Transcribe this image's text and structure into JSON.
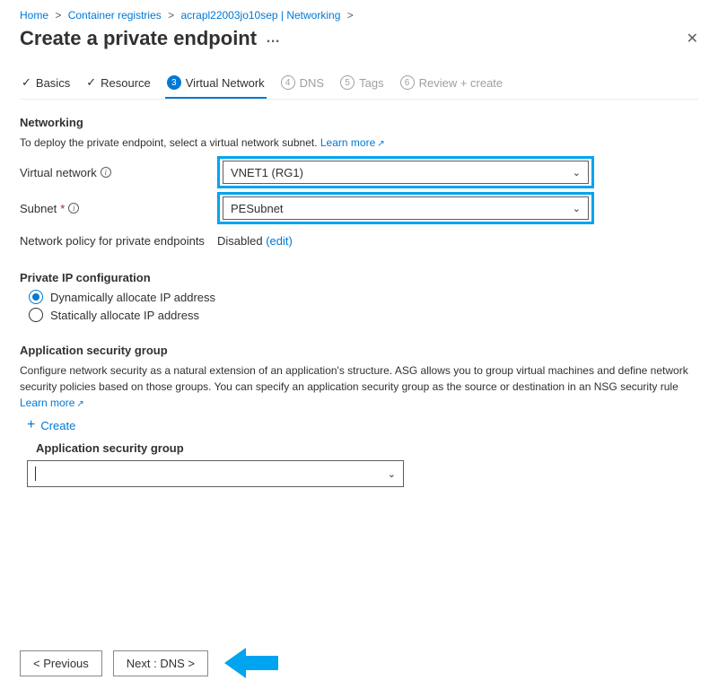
{
  "breadcrumb": {
    "home": "Home",
    "registries": "Container registries",
    "resource": "acrapl22003jo10sep | Networking"
  },
  "header": {
    "title": "Create a private endpoint"
  },
  "tabs": {
    "basics": "Basics",
    "resource": "Resource",
    "vnet_num": "3",
    "vnet": "Virtual Network",
    "dns_num": "4",
    "dns": "DNS",
    "tags_num": "5",
    "tags": "Tags",
    "review_num": "6",
    "review": "Review + create"
  },
  "networking": {
    "heading": "Networking",
    "desc": "To deploy the private endpoint, select a virtual network subnet.",
    "learn_more": "Learn more",
    "vnet_label": "Virtual network",
    "vnet_value": "VNET1 (RG1)",
    "subnet_label": "Subnet",
    "subnet_value": "PESubnet",
    "policy_label": "Network policy for private endpoints",
    "policy_value": "Disabled",
    "policy_edit": "(edit)"
  },
  "ipconfig": {
    "heading": "Private IP configuration",
    "dynamic": "Dynamically allocate IP address",
    "static": "Statically allocate IP address"
  },
  "asg": {
    "heading": "Application security group",
    "desc": "Configure network security as a natural extension of an application's structure. ASG allows you to group virtual machines and define network security policies based on those groups. You can specify an application security group as the source or destination in an NSG security rule",
    "learn_more": "Learn more",
    "create": "Create",
    "list_label": "Application security group"
  },
  "footer": {
    "prev": "< Previous",
    "next": "Next : DNS >"
  }
}
